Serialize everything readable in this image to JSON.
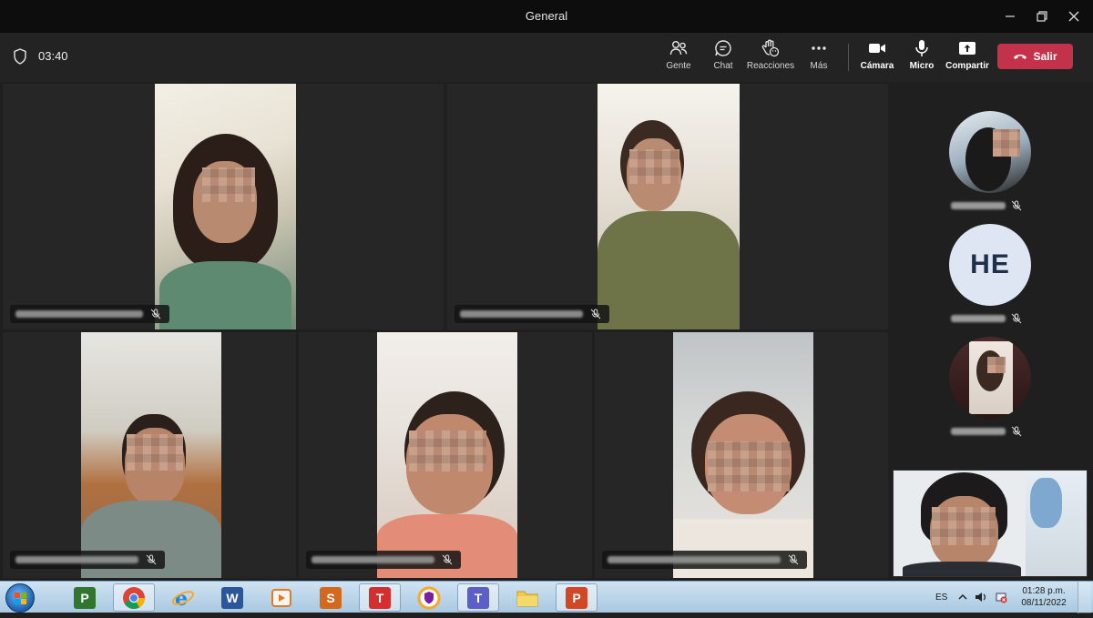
{
  "window": {
    "title": "General"
  },
  "header": {
    "timer": "03:40",
    "controls": [
      {
        "icon": "people-icon",
        "label": "Gente"
      },
      {
        "icon": "chat-icon",
        "label": "Chat"
      },
      {
        "icon": "reactions-icon",
        "label": "Reacciones"
      },
      {
        "icon": "more-icon",
        "label": "Más"
      },
      {
        "icon": "camera-icon",
        "label": "Cámara"
      },
      {
        "icon": "mic-icon",
        "label": "Micro"
      },
      {
        "icon": "share-icon",
        "label": "Compartir"
      }
    ],
    "leave_label": "Salir",
    "leave_color": "#c4314b"
  },
  "roster": [
    {
      "type": "photo"
    },
    {
      "type": "initials",
      "initials": "HE"
    },
    {
      "type": "photo"
    }
  ],
  "taskbar": {
    "apps": [
      "project-icon",
      "chrome-icon",
      "internet-explorer-icon",
      "word-icon",
      "media-player-icon",
      "sway-icon",
      "todoist-icon",
      "vpn-icon",
      "teams-icon",
      "file-explorer-icon",
      "powerpoint-icon"
    ],
    "language": "ES",
    "time": "01:28 p.m.",
    "date": "08/11/2022"
  }
}
